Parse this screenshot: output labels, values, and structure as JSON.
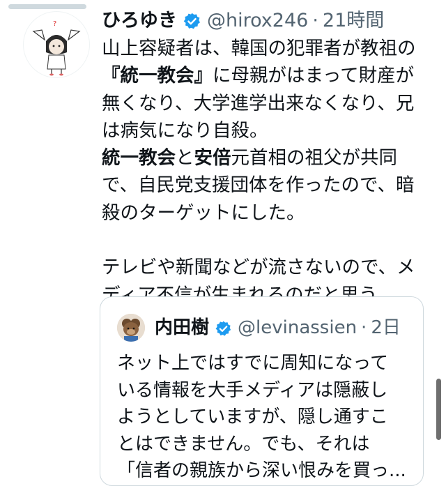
{
  "tweet": {
    "author_name": "ひろゆき",
    "handle": "@hirox246",
    "separator": "·",
    "time": "21時間",
    "lines": [
      [
        {
          "t": "山上容疑者は、韓国の犯罪者が教祖の"
        }
      ],
      [
        {
          "t": "『統一教会』",
          "b": true
        },
        {
          "t": "に母親がはまって財産が"
        }
      ],
      [
        {
          "t": "無くなり、大学進学出来なくなり、兄"
        }
      ],
      [
        {
          "t": "は病気になり自殺。"
        }
      ],
      [
        {
          "t": "統一教会",
          "b": true
        },
        {
          "t": "と"
        },
        {
          "t": "安倍",
          "b": true
        },
        {
          "t": "元首相の祖父が共同"
        }
      ],
      [
        {
          "t": "で、自民党支援団体を作ったので、暗"
        }
      ],
      [
        {
          "t": "殺のターゲットにした。"
        }
      ],
      [],
      [
        {
          "t": "テレビや新聞などが流さないので、メ"
        }
      ],
      [
        {
          "t": "ディア不信が生まれるのだと思う。。"
        }
      ]
    ]
  },
  "quote": {
    "author_name": "内田樹",
    "handle": "@levinassien",
    "separator": "·",
    "time": "2日",
    "lines": [
      "ネット上ではすでに周知になって",
      "いる情報を大手メディアは隠蔽し",
      "ようとしていますが、隠し通すこ",
      "とはできません。でも、それは",
      "「信者の親族から深い恨みを買っ..."
    ]
  },
  "icons": {
    "verified": "verified-badge-icon",
    "verified_color": "#1d9bf0"
  },
  "colors": {
    "text": "#0f1419",
    "secondary": "#536471",
    "border": "#cfd9de"
  }
}
